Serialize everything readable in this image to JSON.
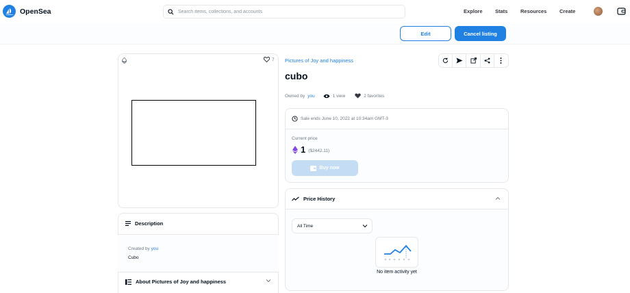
{
  "nav": {
    "brand": "OpenSea",
    "search_placeholder": "Search items, collections, and accounts",
    "links": [
      "Explore",
      "Stats",
      "Resources",
      "Create"
    ]
  },
  "actions": {
    "edit_label": "Edit",
    "cancel_label": "Cancel listing"
  },
  "item": {
    "favorites_count": "7",
    "collection": "Pictures of Joy and happiness",
    "title": "cubo",
    "owned_by_prefix": "Owned by",
    "owner": "you",
    "views": "1 view",
    "favorites": "2 favorites"
  },
  "sale": {
    "ends_text": "Sale ends June 10, 2022 at 10:34am GMT-3",
    "current_price_label": "Current price",
    "price": "1",
    "price_usd": "($2442.11)",
    "buy_label": "Buy now"
  },
  "price_history": {
    "title": "Price History",
    "range_selected": "All Time",
    "empty_text": "No item activity yet"
  },
  "description": {
    "title": "Description",
    "created_by_prefix": "Created by",
    "creator": "you",
    "text": "Cubo",
    "about_title": "About Pictures of Joy and happiness"
  },
  "colors": {
    "accent": "#2081e2",
    "text": "#04111d",
    "muted": "#707a83",
    "border": "#e5e8eb",
    "eth": "#8247e5"
  },
  "icons": [
    "opensea-logo-icon",
    "search-icon",
    "wallet-icon",
    "ethereum-icon",
    "heart-icon",
    "refresh-icon",
    "send-icon",
    "external-link-icon",
    "share-icon",
    "more-icon",
    "eye-icon",
    "clock-icon",
    "trend-icon",
    "chevron-up-icon",
    "chevron-down-icon",
    "description-icon",
    "about-icon",
    "wallet-card-icon"
  ]
}
